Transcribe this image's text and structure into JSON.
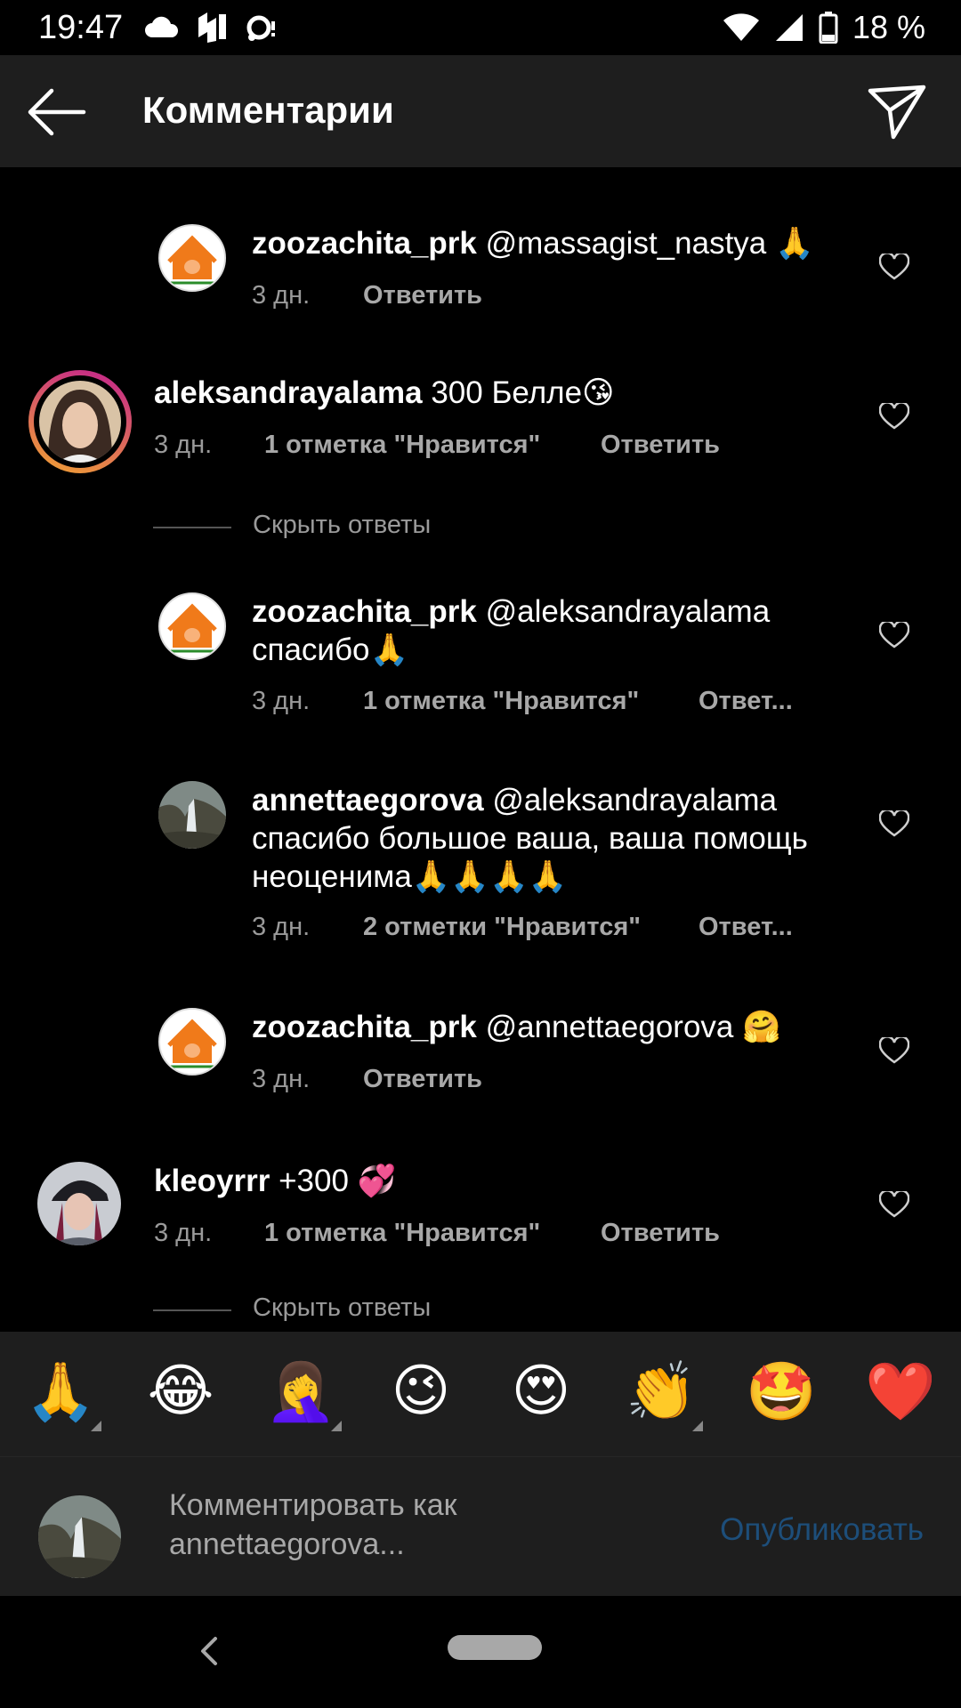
{
  "status_bar": {
    "time": "19:47",
    "battery": "18 %"
  },
  "header": {
    "title": "Комментарии"
  },
  "comments": [
    {
      "username": "zoozachita_prk",
      "text": "@massagist_nastya 🙏",
      "time": "3 дн.",
      "likes": "",
      "reply": "Ответить"
    },
    {
      "username": "aleksandrayalama",
      "text": "300 Белле😘",
      "time": "3 дн.",
      "likes": "1 отметка \"Нравится\"",
      "reply": "Ответить"
    },
    {
      "username": "zoozachita_prk",
      "text": "@aleksandrayalama спасибо🙏",
      "time": "3 дн.",
      "likes": "1 отметка \"Нравится\"",
      "reply": "Ответ..."
    },
    {
      "username": "annettaegorova",
      "text": "@aleksandrayalama спасибо большое ваша, ваша помощь неоценима🙏🙏🙏🙏",
      "time": "3 дн.",
      "likes": "2 отметки \"Нравится\"",
      "reply": "Ответ..."
    },
    {
      "username": "zoozachita_prk",
      "text": "@annettaegorova 🤗",
      "time": "3 дн.",
      "likes": "",
      "reply": "Ответить"
    },
    {
      "username": "kleoyrrr",
      "text": "+300 💞",
      "time": "3 дн.",
      "likes": "1 отметка \"Нравится\"",
      "reply": "Ответить"
    }
  ],
  "hide_replies": "Скрыть ответы",
  "emoji_bar": [
    "🙏",
    "😂",
    "🤦‍♀️",
    "😉",
    "😍",
    "👏",
    "🤩",
    "❤️"
  ],
  "comment_input": {
    "placeholder": "Комментировать как annettaegorova...",
    "publish": "Опубликовать"
  },
  "colors": {
    "background": "#000000",
    "surface": "#1e1e1e",
    "muted_text": "#9a9a9a",
    "publish_disabled": "#1d4e7a",
    "story_ring_start": "#f2a531",
    "story_ring_end": "#c2208f"
  }
}
